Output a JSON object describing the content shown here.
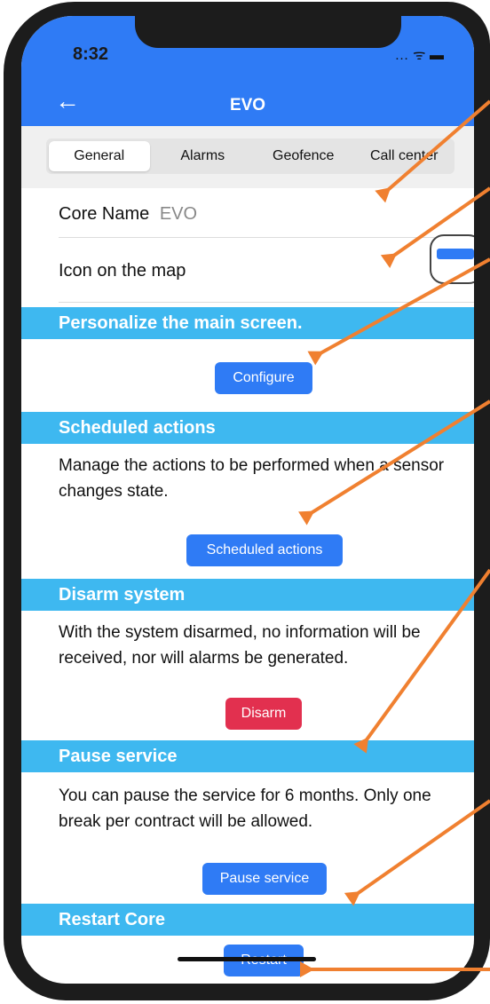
{
  "status_bar": {
    "time": "8:32",
    "icons": "… ᯤ ▬"
  },
  "nav": {
    "back_icon": "←",
    "title": "EVO"
  },
  "tabs": [
    {
      "label": "General",
      "active": true
    },
    {
      "label": "Alarms",
      "active": false
    },
    {
      "label": "Geofence",
      "active": false
    },
    {
      "label": "Call center",
      "active": false
    }
  ],
  "general": {
    "core_name_label": "Core Name",
    "core_name_value": "EVO",
    "icon_on_map_label": "Icon on the map"
  },
  "sections": {
    "personalize": {
      "title": "Personalize the main screen.",
      "button": "Configure"
    },
    "scheduled": {
      "title": "Scheduled actions",
      "description": "Manage the actions to be performed when a sensor changes state.",
      "button": "Scheduled actions"
    },
    "disarm": {
      "title": "Disarm system",
      "description": "With the system disarmed, no information will be received, nor will alarms be generated.",
      "button": "Disarm"
    },
    "pause": {
      "title": "Pause service",
      "description": "You can pause the service for 6 months. Only one break per contract will be allowed.",
      "button": "Pause service"
    },
    "restart": {
      "title": "Restart Core",
      "button": "Restart"
    }
  },
  "colors": {
    "header_blue": "#2f7bf5",
    "section_bar": "#3eb8f0",
    "disarm_red": "#e2304f",
    "annotation_arrow": "#f08030"
  },
  "icons": [
    "back-arrow-icon",
    "map-marker-icon",
    "wifi-icon",
    "battery-icon"
  ]
}
